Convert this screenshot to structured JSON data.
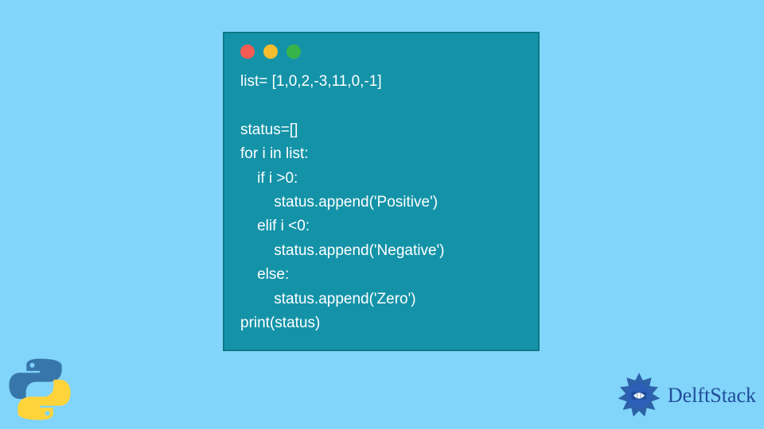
{
  "code": {
    "lines": [
      "list= [1,0,2,-3,11,0,-1]",
      "",
      "status=[]",
      "for i in list:",
      "    if i >0:",
      "        status.append('Positive')",
      "    elif i <0:",
      "        status.append('Negative')",
      "    else:",
      "        status.append('Zero')",
      "print(status)"
    ]
  },
  "brand": {
    "name": "DelftStack"
  },
  "colors": {
    "background": "#81d4fa",
    "window": "#1493a8",
    "windowBorder": "#0e7786",
    "dotRed": "#f45b53",
    "dotYellow": "#f8bd2f",
    "dotGreen": "#38b34a",
    "brandBlue": "#1f4d9a"
  }
}
